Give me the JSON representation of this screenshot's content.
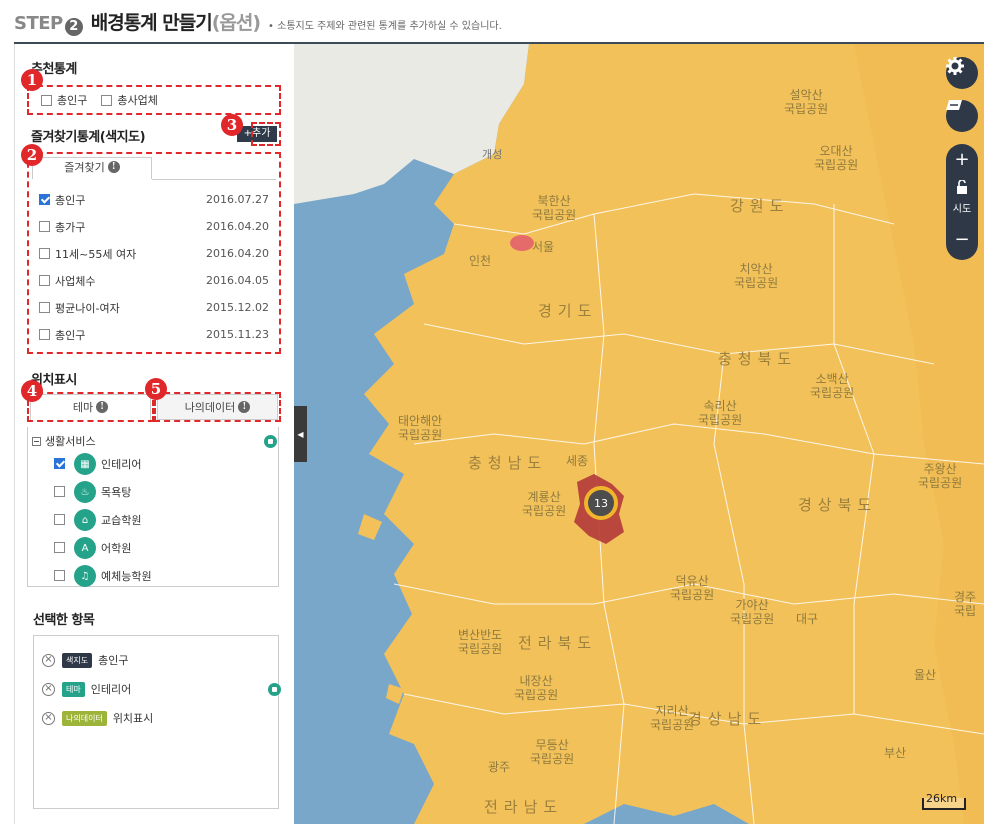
{
  "header": {
    "step_word": "STEP",
    "step_num": "2",
    "title": "배경통계 만들기",
    "subtitle": "(옵션)",
    "desc": "• 소통지도 주제와 관련된 통계를 추가하실 수 있습니다."
  },
  "recommend": {
    "title": "추천통계",
    "items": [
      {
        "label": "총인구",
        "checked": false
      },
      {
        "label": "총사업체",
        "checked": false
      }
    ]
  },
  "favorites": {
    "title": "즐겨찾기통계(색지도)",
    "add_label": "+추가",
    "tab_label": "즐겨찾기",
    "items": [
      {
        "label": "총인구",
        "date": "2016.07.27",
        "checked": true
      },
      {
        "label": "총가구",
        "date": "2016.04.20",
        "checked": false
      },
      {
        "label": "11세~55세 여자",
        "date": "2016.04.20",
        "checked": false
      },
      {
        "label": "사업체수",
        "date": "2016.04.05",
        "checked": false
      },
      {
        "label": "평균나이-여자",
        "date": "2015.12.02",
        "checked": false
      },
      {
        "label": "총인구",
        "date": "2015.11.23",
        "checked": false
      }
    ]
  },
  "location": {
    "title": "위치표시",
    "tab_theme": "테마",
    "tab_mydata": "나의데이터",
    "tree_root": "생활서비스",
    "items": [
      {
        "label": "인테리어",
        "checked": true,
        "icon": "building-icon"
      },
      {
        "label": "목욕탕",
        "checked": false,
        "icon": "bath-icon"
      },
      {
        "label": "교습학원",
        "checked": false,
        "icon": "book-icon"
      },
      {
        "label": "어학원",
        "checked": false,
        "icon": "language-icon"
      },
      {
        "label": "예체능학원",
        "checked": false,
        "icon": "music-icon"
      }
    ]
  },
  "selected": {
    "title": "선택한 항목",
    "items": [
      {
        "badge": "색지도",
        "label": "총인구",
        "badge_color": "#2e3847"
      },
      {
        "badge": "테마",
        "label": "인테리어",
        "badge_color": "#24a38a"
      },
      {
        "badge": "나의데이터",
        "label": "위치표시",
        "badge_color": "#9cb43a"
      }
    ]
  },
  "markers": [
    "1",
    "2",
    "3",
    "4",
    "5"
  ],
  "map": {
    "controls": {
      "zoom_in": "+",
      "zoom_out": "−",
      "sido": "시도"
    },
    "cluster_count": "13",
    "scale": "26km",
    "labels": {
      "seorak": "설악산\n국립공원",
      "odaesan": "오대산\n국립공원",
      "gangwon": "강원도",
      "bukhan": "북한산\n국립공원",
      "seoul": "서울",
      "incheon": "인천",
      "gaeseong": "개성",
      "gyeonggi": "경기도",
      "chiak": "치악산\n국립공원",
      "chungbuk": "충청북도",
      "sobaek": "소백산\n국립공원",
      "songni": "속리산\n국립공원",
      "taean": "태안해안\n국립공원",
      "chungnam": "충청남도",
      "sejong": "세종",
      "gyeryong": "계룡산\n국립공원",
      "juwang": "주왕산\n국립공원",
      "gyeongbuk": "경상북도",
      "deogyu": "덕유산\n국립공원",
      "gaya": "가야산\n국립공원",
      "daegu": "대구",
      "byeonsan": "변산반도\n국립공원",
      "jeonbuk": "전라북도",
      "naejang": "내장산\n국립공원",
      "jiri": "지리산\n국립공원",
      "gyeongnam": "경상남도",
      "ulsan": "울산",
      "mudeung": "무등산\n국립공원",
      "gwangju": "광주",
      "jeonnam": "전라남도",
      "busan": "부산",
      "gyeongju": "경주\n국립"
    }
  },
  "colors": {
    "accent_red": "#e0282b",
    "land": "#f3c15a",
    "sea": "#79a7c9",
    "theme_green": "#24a38a",
    "dark": "#2e3847"
  }
}
